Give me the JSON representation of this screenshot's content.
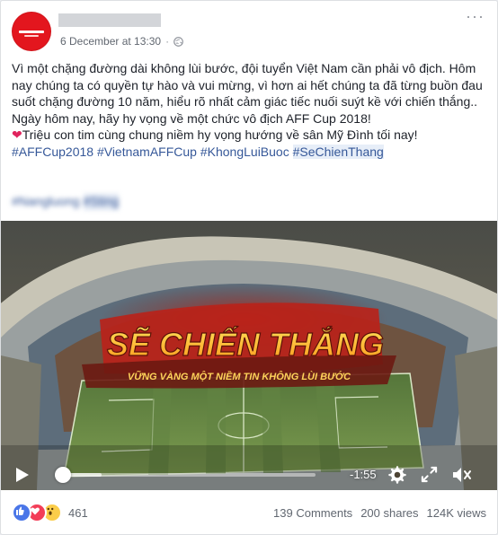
{
  "post": {
    "date": "6 December at 13:30",
    "privacy_separator": "·",
    "privacy_icon": "globe-icon",
    "more_icon": "more-icon",
    "brand_color": "#e3161e",
    "link_color": "#365899",
    "paragraphs": [
      "Vì một chặng đường dài không lùi bước, đội tuyển Việt Nam cần phải vô địch. Hôm nay chúng ta có quyền tự hào và vui mừng, vì hơn ai hết chúng ta đã từng buồn đau suốt chặng đường 10 năm, hiểu rõ nhất cảm giác tiếc nuối suýt kề với chiến thắng..",
      "Ngày hôm nay, hãy hy vọng về một chức vô địch AFF Cup 2018!"
    ],
    "heart_glyph": "❤",
    "line3": "Triệu con tim cùng chung niềm hy vọng hướng về sân Mỹ Đình tối nay!",
    "hashtags": [
      "#AFFCup2018",
      "#VietnamAFFCup",
      "#KhongLuiBuoc",
      "#SeChienThang"
    ],
    "blurred_hashtags": [
      "#Nangluong",
      "#Sting"
    ]
  },
  "video": {
    "title_art": "SẼ CHIẾN THẮNG",
    "subtitle_art": "VỮNG VÀNG MỘT NIỀM TIN KHÔNG LÙI BƯỚC",
    "time_remaining": "-1:55",
    "progress": 0.03,
    "buffered": 0.18,
    "play_icon": "play-icon",
    "settings_icon": "gear-icon",
    "fullscreen_icon": "expand-icon",
    "volume_icon": "volume-muted-icon"
  },
  "footer": {
    "reaction_types": [
      "like",
      "love",
      "wow"
    ],
    "reaction_count": "461",
    "comments": "139 Comments",
    "shares": "200 shares",
    "views": "124K views"
  }
}
